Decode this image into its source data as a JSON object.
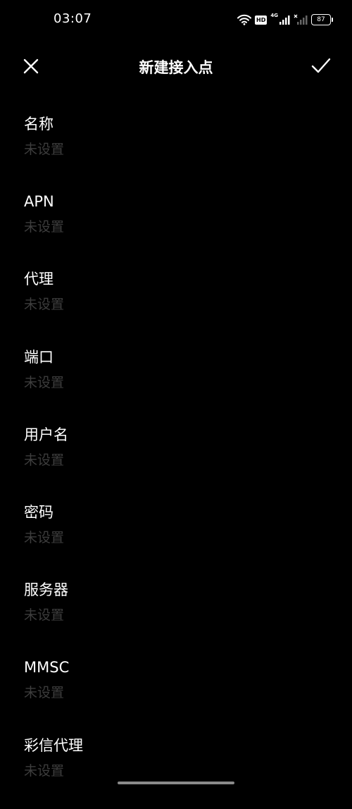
{
  "status_bar": {
    "time": "03:07",
    "battery": "87",
    "hd_label": "HD",
    "net_label": "4G",
    "icons": [
      "wifi-icon",
      "hd-icon",
      "signal-4g-icon",
      "signal-no-sim-icon",
      "battery-icon"
    ]
  },
  "header": {
    "title": "新建接入点",
    "close_icon": "close-icon",
    "confirm_icon": "check-icon"
  },
  "fields": [
    {
      "label": "名称",
      "value": "未设置"
    },
    {
      "label": "APN",
      "value": "未设置"
    },
    {
      "label": "代理",
      "value": "未设置"
    },
    {
      "label": "端口",
      "value": "未设置"
    },
    {
      "label": "用户名",
      "value": "未设置"
    },
    {
      "label": "密码",
      "value": "未设置"
    },
    {
      "label": "服务器",
      "value": "未设置"
    },
    {
      "label": "MMSC",
      "value": "未设置"
    },
    {
      "label": "彩信代理",
      "value": "未设置"
    }
  ],
  "colors": {
    "background": "#000000",
    "label": "#ffffff",
    "placeholder_value": "#3d3d3d"
  }
}
